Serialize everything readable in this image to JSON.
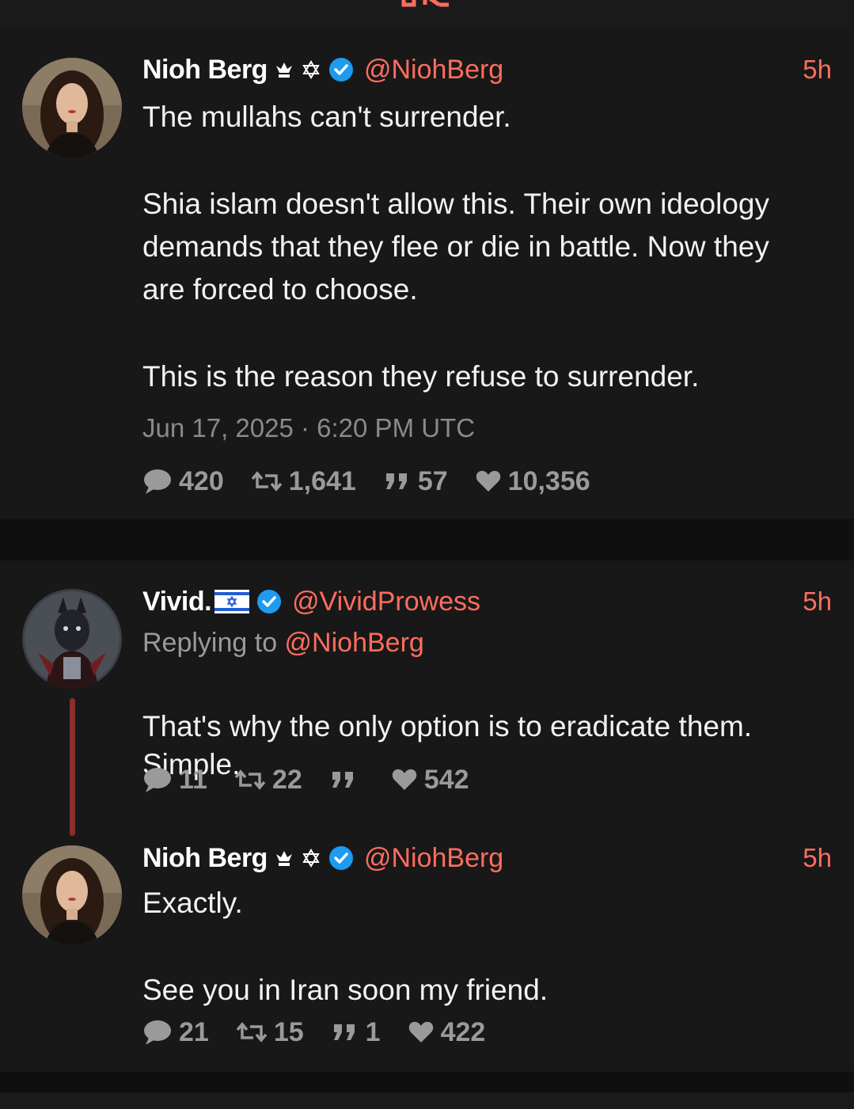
{
  "tweets": [
    {
      "name": "Nioh Berg",
      "handle": "@NiohBerg",
      "time": "5h",
      "paragraphs": [
        "The mullahs can't surrender.",
        "Shia islam doesn't allow this. Their own ideology demands that they flee or die in battle. Now they are forced to choose.",
        "This is the reason they refuse to surrender."
      ],
      "date": "Jun 17, 2025 · 6:20 PM UTC",
      "replies": "420",
      "retweets": "1,641",
      "quotes": "57",
      "likes": "10,356"
    },
    {
      "name": "Vivid.",
      "handle": "@VividProwess",
      "time": "5h",
      "replying_label": "Replying to ",
      "replying_to": "@NiohBerg",
      "paragraphs": [
        "That's why the only option is to eradicate them.\nSimple."
      ],
      "replies": "11",
      "retweets": "22",
      "quotes": "",
      "likes": "542"
    },
    {
      "name": "Nioh Berg",
      "handle": "@NiohBerg",
      "time": "5h",
      "paragraphs": [
        "Exactly.",
        "See you in Iran soon my friend."
      ],
      "replies": "21",
      "retweets": "15",
      "quotes": "1",
      "likes": "422"
    }
  ],
  "icons": {
    "crown": "crown-icon",
    "star_of_david": "star-of-david-icon",
    "verified": "verified-badge-icon",
    "flag": "israel-flag-icon",
    "reply": "comment-icon",
    "retweet": "retweet-icon",
    "quote": "quote-icon",
    "like": "heart-icon"
  },
  "colors": {
    "accent": "#ff6d5e",
    "verified": "#1d9bf0",
    "background": "#181818",
    "thread_line": "#8a2e2a"
  }
}
